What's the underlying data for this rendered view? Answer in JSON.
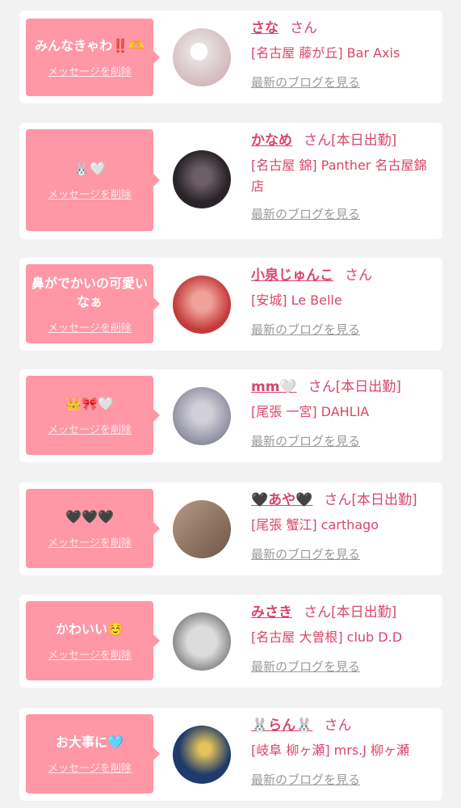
{
  "items": [
    {
      "message": "みんなきゃわ‼️🫶",
      "delete_label": "メッセージを削除",
      "name": "さな",
      "honorific": "さん",
      "status": "",
      "shop": "[名古屋 藤が丘] Bar Axis",
      "blog_link": "最新のブログを見る",
      "avatar_colors": [
        "#e6e0e0",
        "#c9a3a8"
      ]
    },
    {
      "message": "🐰🤍",
      "delete_label": "メッセージを削除",
      "name": "かなめ",
      "honorific": "さん",
      "status": "[本日出勤]",
      "shop": "[名古屋 錦] Panther 名古屋錦店",
      "blog_link": "最新のブログを見る",
      "avatar_colors": [
        "#2a2428",
        "#6b5e64"
      ]
    },
    {
      "message": "鼻がでかいの可愛いなぁ",
      "delete_label": "メッセージを削除",
      "name": "小泉じゅんこ",
      "honorific": "さん",
      "status": "",
      "shop": "[安城] Le Belle",
      "blog_link": "最新のブログを見る",
      "avatar_colors": [
        "#c33a3a",
        "#f0a19a"
      ]
    },
    {
      "message": "👑🎀🤍",
      "delete_label": "メッセージを削除",
      "name": "mm🤍",
      "honorific": "さん",
      "status": "[本日出勤]",
      "shop": "[尾張 一宮] DAHLIA",
      "blog_link": "最新のブログを見る",
      "avatar_colors": [
        "#8d8fa0",
        "#d2cfd8"
      ]
    },
    {
      "message": "🖤🖤🖤",
      "delete_label": "メッセージを削除",
      "name": "🖤あや🖤",
      "honorific": "さん",
      "status": "[本日出勤]",
      "shop": "[尾張 蟹江] carthago",
      "blog_link": "最新のブログを見る",
      "avatar_colors": [
        "#6e5546",
        "#b49a86"
      ]
    },
    {
      "message": "かわいい☺️",
      "delete_label": "メッセージを削除",
      "name": "みさき",
      "honorific": "さん",
      "status": "[本日出勤]",
      "shop": "[名古屋 大曽根] club D.D",
      "blog_link": "最新のブログを見る",
      "avatar_colors": [
        "#dcdcdc",
        "#7b7676"
      ]
    },
    {
      "message": "お大事に🩵",
      "delete_label": "メッセージを削除",
      "name": "🐰らん🐰",
      "honorific": "さん",
      "status": "",
      "shop": "[岐阜 柳ヶ瀬] mrs.J 柳ヶ瀬",
      "blog_link": "最新のブログを見る",
      "avatar_colors": [
        "#1f3a6b",
        "#e5c35a"
      ]
    }
  ]
}
